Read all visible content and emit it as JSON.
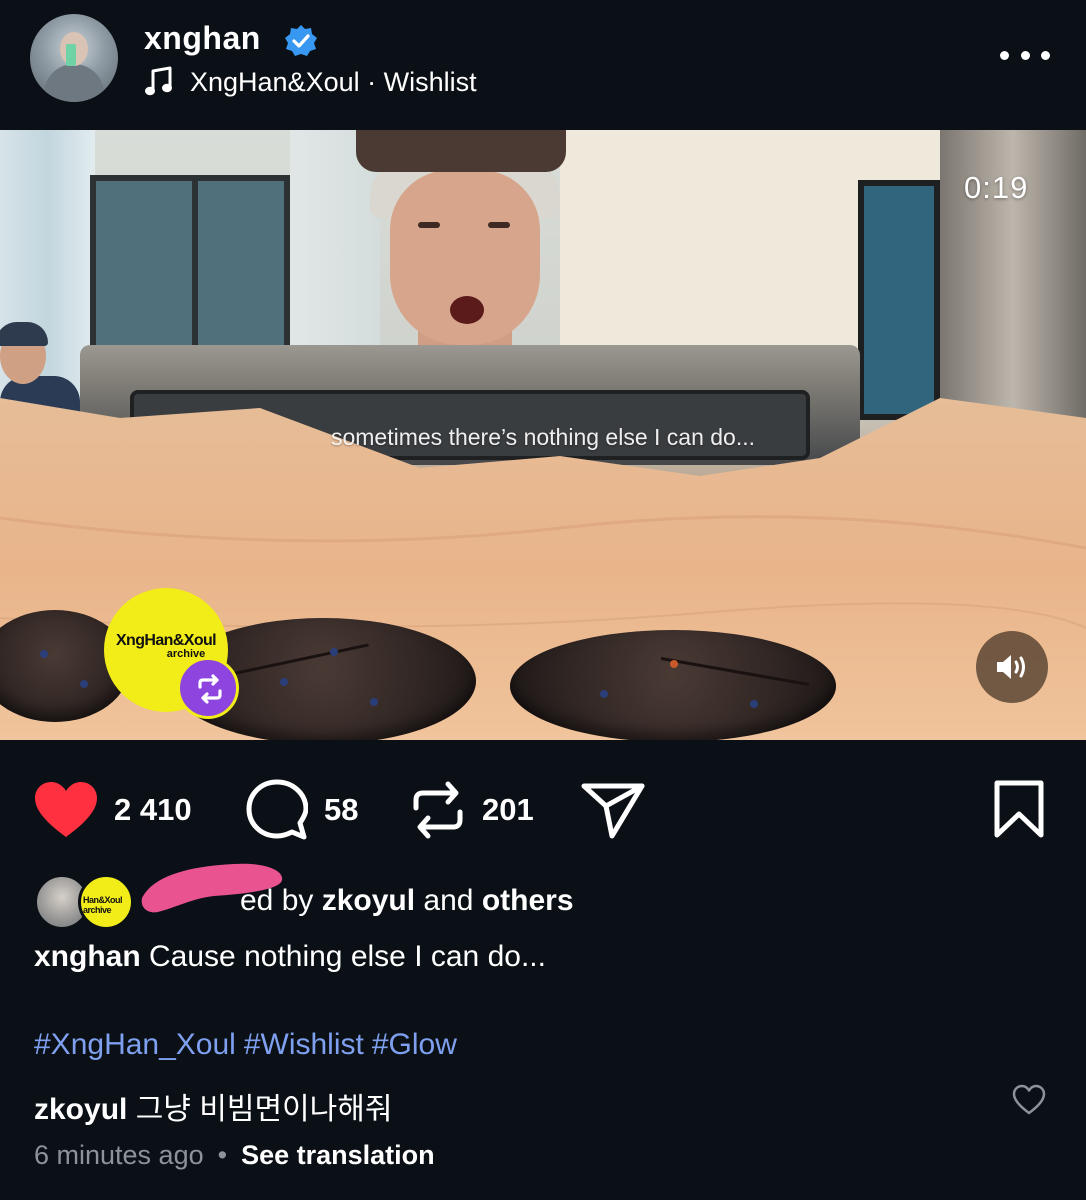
{
  "header": {
    "username": "xnghan",
    "verified": true,
    "audio": "XngHan&Xoul · Wishlist",
    "icons": [
      "verified-badge-icon",
      "music-note-icon",
      "more-icon"
    ]
  },
  "video": {
    "subtitle": "sometimes there’s nothing else I can do...",
    "timer": "0:19",
    "collab_name": "XngHan&Xoul",
    "collab_sub": "archive",
    "icons": [
      "repost-icon",
      "speaker-icon"
    ]
  },
  "actions": {
    "likes": "2 410",
    "comments": "58",
    "reposts": "201",
    "icons": [
      "heart-filled-icon",
      "comment-icon",
      "repost-icon",
      "share-icon",
      "bookmark-icon"
    ]
  },
  "liked_by": {
    "prefix": "ed by ",
    "user": "zkoyul",
    "middle": " and ",
    "others": "others",
    "avatar_badge": "Han&Xoul archive"
  },
  "caption": {
    "user": "xnghan",
    "text": "Cause nothing else I can do..."
  },
  "hashtags": [
    "#XngHan_Xoul",
    "#Wishlist",
    "#Glow"
  ],
  "comment": {
    "user": "zkoyul",
    "text": "그냥 비빔면이나해줘"
  },
  "meta": {
    "time": "6 minutes ago",
    "separator": "•",
    "translate": "See translation"
  },
  "colors": {
    "background": "#0b1016",
    "like_red": "#ff3040",
    "hashtag_blue": "#7fa0f0",
    "collab_yellow": "#f2ec18",
    "repost_purple": "#8e45e0",
    "verified_blue": "#3897f0"
  }
}
